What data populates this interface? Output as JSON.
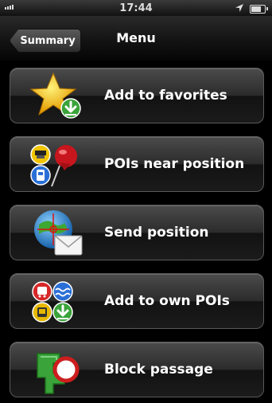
{
  "status_bar": {
    "time": "17:44"
  },
  "nav": {
    "back_label": "Summary",
    "title": "Menu"
  },
  "menu": {
    "items": [
      {
        "label": "Add to favorites",
        "icon": "star-download-icon"
      },
      {
        "label": "POIs near position",
        "icon": "poi-pin-icon"
      },
      {
        "label": "Send position",
        "icon": "globe-mail-icon"
      },
      {
        "label": "Add to own POIs",
        "icon": "poi-add-icon"
      },
      {
        "label": "Block passage",
        "icon": "block-passage-icon"
      }
    ]
  },
  "colors": {
    "background": "#000000",
    "button_top": "#4b4b4b",
    "button_bottom": "#121212",
    "accent_green": "#3aa33a",
    "accent_red": "#cc1e1e"
  }
}
